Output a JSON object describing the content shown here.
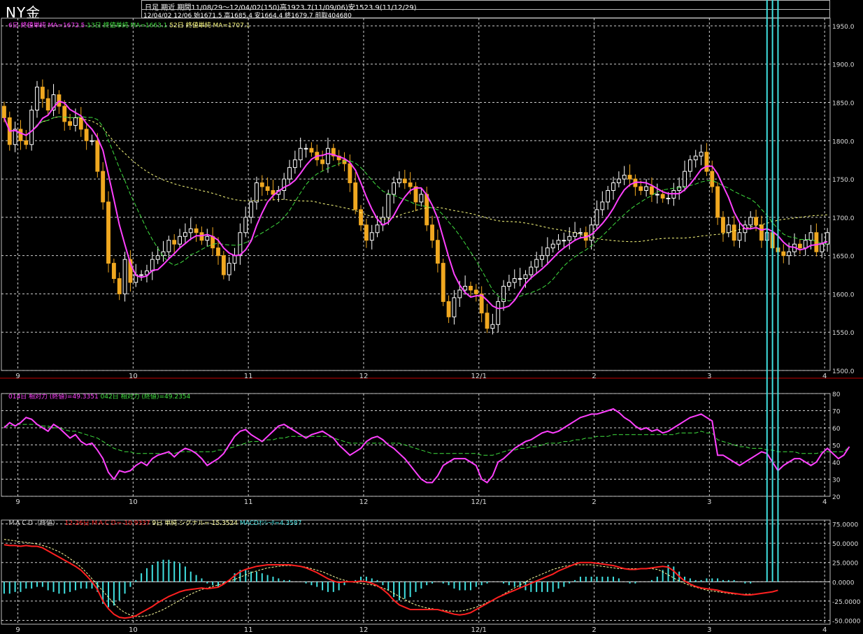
{
  "header": {
    "title": "NY金",
    "info_line1": "日足 期近 期間11/08/29～12/04/02(150)高1923.7(11/09/06)安1523.9(11/12/29)",
    "info_line2": "12/04/02 12/06 始1671.5 高1685.4 安1664.4 終1679.7 前取404680"
  },
  "colors": {
    "background": "#000000",
    "grid": "#cfcfcf",
    "candle_up": "#ffffff",
    "candle_down": "#f0a820",
    "ma6": "#ff40ff",
    "ma13": "#40e040",
    "ma52": "#ffff80",
    "rsi14": "#ff40ff",
    "rsi42": "#40e040",
    "macd": "#ff2020",
    "signal": "#ffffa0",
    "histogram": "#40e0e0",
    "separator": "#c00000"
  },
  "chart_data": [
    {
      "type": "candlestick",
      "legend": [
        {
          "text": "6日 終値単純 MA=1672.5",
          "color": "#ff40ff"
        },
        {
          "text": "13日 終値単純 MA=1663.1",
          "color": "#40e040"
        },
        {
          "text": "52日 終値単純 MA=1707.1",
          "color": "#ffff80"
        }
      ],
      "x_ticks": [
        "9",
        "10",
        "11",
        "12",
        "12/1",
        "2",
        "3",
        "4"
      ],
      "x_tick_index": [
        3,
        24,
        45,
        66,
        87,
        108,
        129,
        150
      ],
      "ylim": [
        1500,
        1960
      ],
      "y_ticks": [
        "1500.0",
        "1550.0",
        "1600.0",
        "1650.0",
        "1700.0",
        "1750.0",
        "1800.0",
        "1850.0",
        "1900.0",
        "1950.0"
      ],
      "closes": [
        1830,
        1795,
        1815,
        1800,
        1795,
        1840,
        1870,
        1855,
        1840,
        1860,
        1845,
        1825,
        1820,
        1830,
        1815,
        1800,
        1800,
        1760,
        1720,
        1640,
        1620,
        1600,
        1645,
        1615,
        1625,
        1625,
        1630,
        1645,
        1650,
        1655,
        1670,
        1665,
        1675,
        1680,
        1685,
        1680,
        1670,
        1675,
        1660,
        1650,
        1625,
        1640,
        1650,
        1680,
        1700,
        1720,
        1745,
        1740,
        1735,
        1730,
        1735,
        1750,
        1765,
        1775,
        1790,
        1790,
        1785,
        1775,
        1770,
        1790,
        1780,
        1775,
        1770,
        1745,
        1710,
        1690,
        1670,
        1680,
        1690,
        1700,
        1730,
        1745,
        1750,
        1745,
        1740,
        1720,
        1730,
        1690,
        1670,
        1640,
        1590,
        1570,
        1595,
        1605,
        1610,
        1605,
        1600,
        1575,
        1555,
        1560,
        1590,
        1610,
        1615,
        1620,
        1620,
        1625,
        1635,
        1645,
        1650,
        1660,
        1665,
        1670,
        1670,
        1675,
        1680,
        1680,
        1670,
        1690,
        1710,
        1720,
        1735,
        1745,
        1750,
        1755,
        1750,
        1740,
        1735,
        1740,
        1730,
        1730,
        1725,
        1725,
        1735,
        1740,
        1760,
        1775,
        1780,
        1785,
        1760,
        1740,
        1700,
        1680,
        1690,
        1670,
        1680,
        1690,
        1700,
        1690,
        1670,
        1680,
        1660,
        1655,
        1650,
        1655,
        1665,
        1660,
        1670,
        1680,
        1655,
        1665,
        1680
      ]
    },
    {
      "type": "line",
      "legend": [
        {
          "text": "014日 相対力 (終値)=49.3351",
          "color": "#ff40ff"
        },
        {
          "text": "042日 相対力 (終値)=49.2354",
          "color": "#40e040"
        }
      ],
      "ylim": [
        20,
        80
      ],
      "y_ticks": [
        "20",
        "30",
        "40",
        "50",
        "60",
        "70",
        "80"
      ],
      "series": [
        {
          "values": [
            60,
            63,
            61,
            63,
            66,
            65,
            62,
            60,
            58,
            62,
            60,
            57,
            54,
            56,
            52,
            50,
            51,
            47,
            42,
            34,
            30,
            35,
            34,
            35,
            38,
            40,
            38,
            42,
            44,
            45,
            46,
            43,
            46,
            48,
            47,
            45,
            42,
            38,
            40,
            42,
            45,
            50,
            55,
            58,
            59,
            56,
            54,
            52,
            55,
            58,
            61,
            62,
            60,
            58,
            56,
            54,
            56,
            57,
            58,
            56,
            54,
            50,
            47,
            44,
            46,
            48,
            52,
            54,
            55,
            53,
            50,
            48,
            45,
            42,
            38,
            34,
            30,
            28,
            28,
            32,
            38,
            40,
            42,
            42,
            42,
            40,
            38,
            30,
            28,
            32,
            40,
            42,
            45,
            48,
            50,
            52,
            53,
            55,
            57,
            58,
            57,
            58,
            60,
            62,
            64,
            66,
            67,
            68,
            68,
            69,
            70,
            71,
            69,
            66,
            64,
            61,
            59,
            60,
            58,
            59,
            57,
            58,
            60,
            62,
            64,
            66,
            67,
            68,
            66,
            64,
            44,
            44,
            42,
            40,
            38,
            40,
            42,
            44,
            46,
            45,
            40,
            35,
            38,
            40,
            42,
            42,
            40,
            38,
            40,
            45,
            48,
            45,
            42,
            44,
            49
          ]
        },
        {
          "values": [
            61,
            61,
            62,
            62,
            62,
            62,
            62,
            61,
            61,
            60,
            60,
            59,
            58,
            58,
            57,
            56,
            55,
            54,
            52,
            50,
            48,
            47,
            46,
            46,
            45,
            45,
            45,
            45,
            45,
            45,
            45,
            45,
            46,
            46,
            46,
            46,
            46,
            46,
            46,
            47,
            47,
            48,
            49,
            50,
            51,
            52,
            52,
            52,
            53,
            53,
            54,
            54,
            55,
            55,
            55,
            55,
            55,
            55,
            55,
            55,
            54,
            53,
            52,
            51,
            51,
            51,
            51,
            51,
            51,
            51,
            51,
            51,
            51,
            50,
            49,
            48,
            47,
            46,
            45,
            45,
            45,
            45,
            45,
            45,
            45,
            45,
            45,
            44,
            44,
            44,
            45,
            46,
            47,
            47,
            48,
            48,
            49,
            49,
            50,
            51,
            51,
            51,
            52,
            52,
            53,
            53,
            54,
            54,
            55,
            55,
            55,
            56,
            56,
            56,
            56,
            56,
            56,
            56,
            56,
            56,
            56,
            56,
            56,
            57,
            57,
            57,
            57,
            58,
            57,
            57,
            53,
            52,
            51,
            50,
            49,
            49,
            48,
            48,
            48,
            47,
            47,
            46,
            46,
            46,
            46,
            45,
            45,
            45,
            45,
            46,
            46,
            46,
            46,
            46,
            49
          ]
        }
      ]
    },
    {
      "type": "macd",
      "label": "ＭＡＣＤ（終値）",
      "legend": [
        {
          "text": "12-26日 ＭＡＣＤ=-10.9337",
          "color": "#ff2020"
        },
        {
          "text": "9日 単純 シグナル=-15.3524",
          "color": "#ffffa0"
        },
        {
          "text": "MACDｵｼﾚｰﾀ=4.3587",
          "color": "#40e0e0"
        }
      ],
      "ylim": [
        -55,
        80
      ],
      "y_ticks": [
        "75.0000",
        "50.0000",
        "25.0000",
        "0.0000",
        "-25.0000",
        "-50.0000"
      ],
      "macd": [
        48,
        47,
        47,
        46,
        47,
        46,
        46,
        44,
        40,
        36,
        32,
        28,
        24,
        20,
        15,
        8,
        0,
        -10,
        -25,
        -35,
        -42,
        -46,
        -47,
        -46,
        -44,
        -40,
        -36,
        -32,
        -27,
        -23,
        -19,
        -16,
        -13,
        -11,
        -10,
        -9,
        -8,
        -9,
        -8,
        -7,
        -3,
        2,
        8,
        13,
        16,
        18,
        20,
        21,
        22,
        22,
        22,
        22,
        22,
        21,
        20,
        18,
        15,
        12,
        8,
        4,
        1,
        -1,
        0,
        0,
        0,
        1,
        0,
        -2,
        -5,
        -10,
        -16,
        -24,
        -30,
        -33,
        -36,
        -36,
        -36,
        -36,
        -36,
        -36,
        -38,
        -40,
        -42,
        -43,
        -42,
        -40,
        -36,
        -32,
        -28,
        -24,
        -20,
        -17,
        -14,
        -11,
        -8,
        -5,
        -2,
        1,
        4,
        7,
        10,
        14,
        17,
        20,
        23,
        25,
        25,
        25,
        24,
        23,
        22,
        21,
        19,
        17,
        16,
        16,
        17,
        17,
        18,
        19,
        20,
        19,
        14,
        7,
        1,
        -3,
        -6,
        -8,
        -9,
        -10,
        -11,
        -13,
        -14,
        -15,
        -16,
        -17,
        -17,
        -16,
        -15,
        -14,
        -13,
        -11
      ],
      "signal": [
        55,
        54,
        53,
        52,
        51,
        50,
        49,
        47,
        45,
        42,
        39,
        35,
        30,
        25,
        19,
        12,
        4,
        -4,
        -12,
        -20,
        -28,
        -35,
        -40,
        -43,
        -45,
        -45,
        -44,
        -42,
        -39,
        -36,
        -32,
        -28,
        -24,
        -20,
        -16,
        -13,
        -10,
        -8,
        -6,
        -4,
        -2,
        1,
        3,
        6,
        9,
        12,
        14,
        16,
        18,
        19,
        20,
        21,
        21,
        21,
        20,
        19,
        17,
        15,
        13,
        10,
        7,
        4,
        2,
        0,
        -1,
        -2,
        -3,
        -4,
        -6,
        -8,
        -11,
        -15,
        -19,
        -23,
        -27,
        -30,
        -32,
        -34,
        -35,
        -36,
        -37,
        -38,
        -38,
        -38,
        -37,
        -35,
        -33,
        -30,
        -27,
        -24,
        -20,
        -16,
        -12,
        -8,
        -4,
        0,
        4,
        7,
        10,
        13,
        16,
        18,
        20,
        21,
        22,
        22,
        22,
        22,
        21,
        20,
        19,
        18,
        17,
        17,
        17,
        17,
        17,
        17,
        17,
        16,
        13,
        9,
        5,
        1,
        -2,
        -5,
        -7,
        -9,
        -11,
        -12,
        -13,
        -14,
        -15,
        -16,
        -16,
        -16,
        -16,
        -16,
        -15
      ]
    }
  ]
}
